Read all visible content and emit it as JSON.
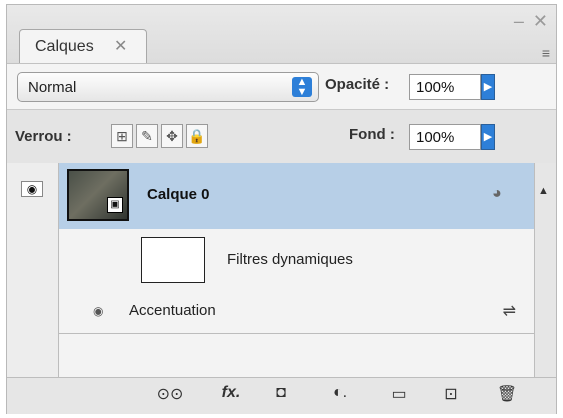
{
  "panel": {
    "tab_label": "Calques",
    "tab_close": "✕",
    "window_controls": "– ✕",
    "menu_icon": "≡"
  },
  "blend": {
    "mode": "Normal",
    "opacity_label": "Opacité :",
    "opacity_value": "100%"
  },
  "lock": {
    "label": "Verrou :",
    "fill_label": "Fond :",
    "fill_value": "100%"
  },
  "layers": {
    "layer_name": "Calque 0",
    "filters_label": "Filtres dynamiques",
    "filter_name": "Accentuation"
  },
  "bottom_icons": [
    {
      "name": "link-layers-icon",
      "glyph": "⊙⊙"
    },
    {
      "name": "fx-icon",
      "glyph": "fx."
    },
    {
      "name": "mask-icon",
      "glyph": "◘"
    },
    {
      "name": "adjustment-layer-icon",
      "glyph": "◐."
    },
    {
      "name": "group-folder-icon",
      "glyph": "▭"
    },
    {
      "name": "new-layer-icon",
      "glyph": "⊡"
    },
    {
      "name": "trash-icon",
      "glyph": "🗑"
    }
  ],
  "colors": {
    "accent_blue": "#2d7fd8",
    "selected_row": "#b7cfe7"
  }
}
